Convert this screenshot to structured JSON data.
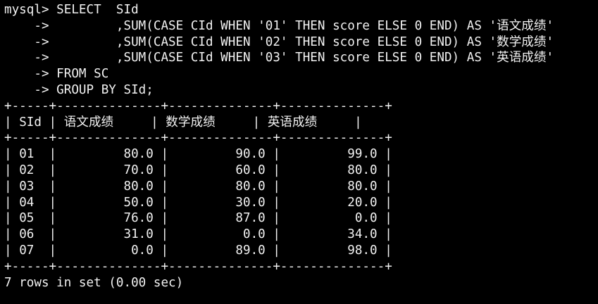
{
  "terminal": {
    "query_lines": [
      "mysql> SELECT  SId",
      "    ->         ,SUM(CASE CId WHEN '01' THEN score ELSE 0 END) AS '语文成绩'",
      "    ->         ,SUM(CASE CId WHEN '02' THEN score ELSE 0 END) AS '数学成绩'",
      "    ->         ,SUM(CASE CId WHEN '03' THEN score ELSE 0 END) AS '英语成绩'",
      "    -> FROM SC",
      "    -> GROUP BY SId;"
    ],
    "table": {
      "border": "+-----+--------------+--------------+--------------+",
      "headers": [
        "SId",
        "语文成绩",
        "数学成绩",
        "英语成绩"
      ],
      "rows": [
        [
          "01",
          "80.0",
          "90.0",
          "99.0"
        ],
        [
          "02",
          "70.0",
          "60.0",
          "80.0"
        ],
        [
          "03",
          "80.0",
          "80.0",
          "80.0"
        ],
        [
          "04",
          "50.0",
          "30.0",
          "20.0"
        ],
        [
          "05",
          "76.0",
          "87.0",
          "0.0"
        ],
        [
          "06",
          "31.0",
          "0.0",
          "34.0"
        ],
        [
          "07",
          "0.0",
          "89.0",
          "98.0"
        ]
      ]
    },
    "footer": "7 rows in set (0.00 sec)"
  }
}
